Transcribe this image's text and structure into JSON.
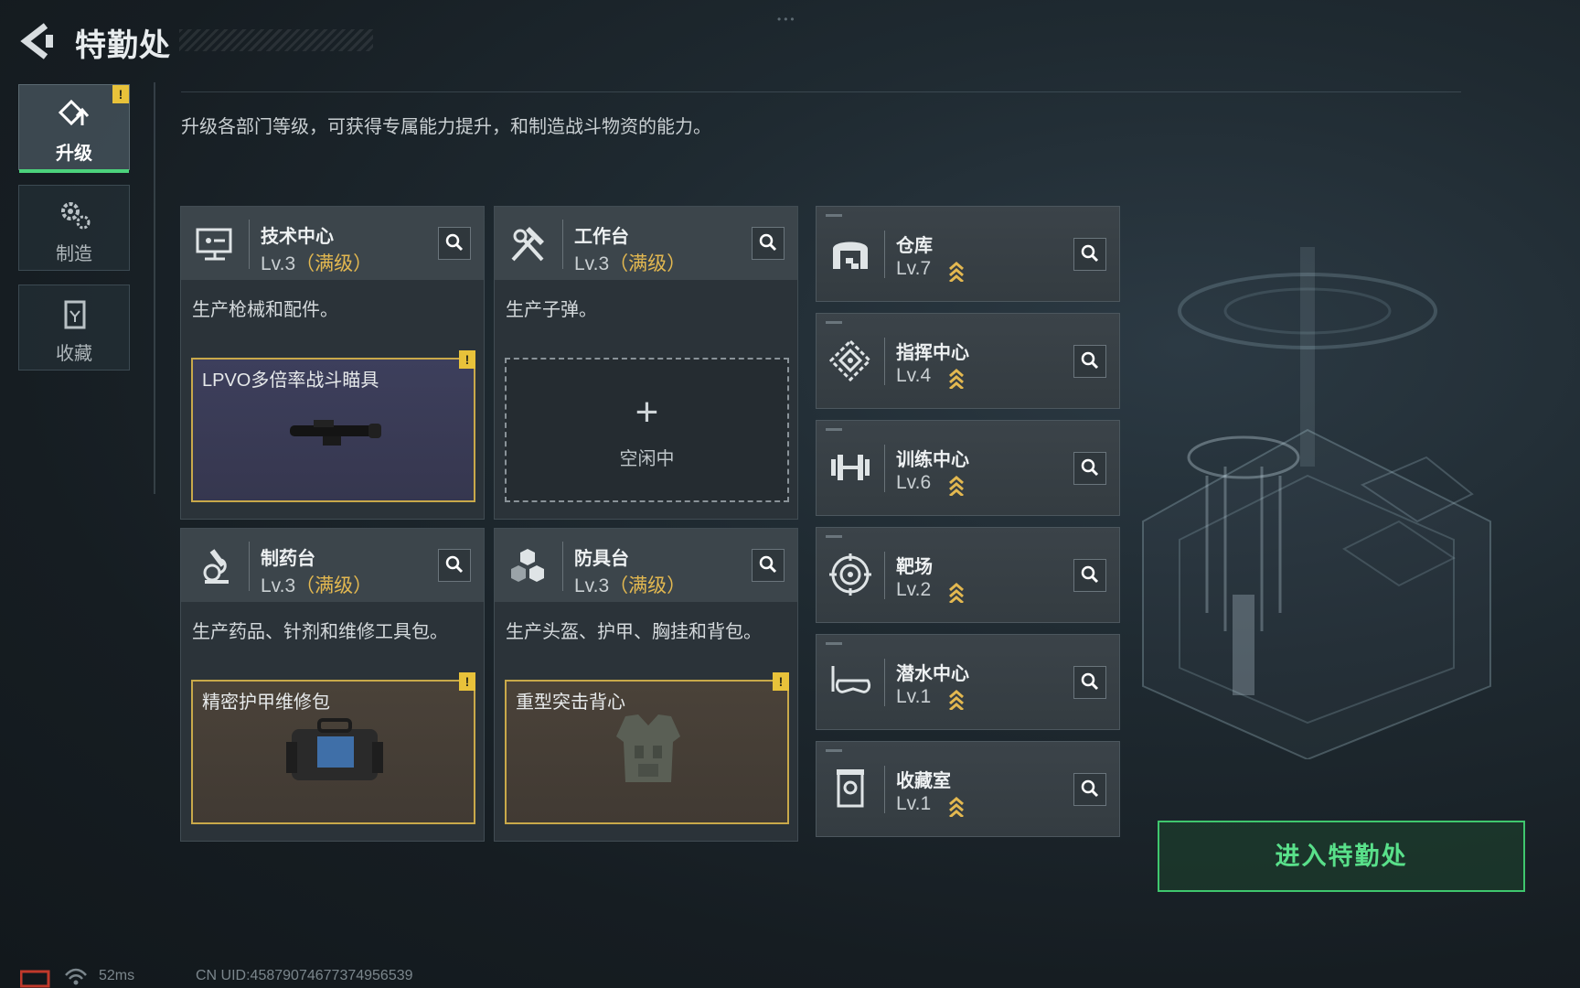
{
  "header": {
    "title": "特勤处"
  },
  "tabs": [
    {
      "label": "升级",
      "active": true,
      "alert": "!"
    },
    {
      "label": "制造",
      "active": false
    },
    {
      "label": "收藏",
      "active": false
    }
  ],
  "description": "升级各部门等级，可获得专属能力提升，和制造战斗物资的能力。",
  "cards": [
    {
      "name": "技术中心",
      "level": "Lv.3",
      "max": "（满级）",
      "desc": "生产枪械和配件。",
      "slot": {
        "item": "LPVO多倍率战斗瞄具",
        "alert": "!"
      }
    },
    {
      "name": "工作台",
      "level": "Lv.3",
      "max": "（满级）",
      "desc": "生产子弹。",
      "slot": {
        "idle_plus": "+",
        "idle_text": "空闲中"
      }
    },
    {
      "name": "制药台",
      "level": "Lv.3",
      "max": "（满级）",
      "desc": "生产药品、针剂和维修工具包。",
      "slot": {
        "item": "精密护甲维修包",
        "alert": "!"
      }
    },
    {
      "name": "防具台",
      "level": "Lv.3",
      "max": "（满级）",
      "desc": "生产头盔、护甲、胸挂和背包。",
      "slot": {
        "item": "重型突击背心",
        "alert": "!"
      }
    }
  ],
  "departments": [
    {
      "name": "仓库",
      "level": "Lv.7"
    },
    {
      "name": "指挥中心",
      "level": "Lv.4"
    },
    {
      "name": "训练中心",
      "level": "Lv.6"
    },
    {
      "name": "靶场",
      "level": "Lv.2"
    },
    {
      "name": "潜水中心",
      "level": "Lv.1"
    },
    {
      "name": "收藏室",
      "level": "Lv.1"
    }
  ],
  "enter_button": "进入特勤处",
  "status": {
    "ping": "52ms",
    "uid": "CN UID:458790746773749565​39"
  },
  "colors": {
    "accent": "#4cd27c",
    "max_level": "#e3b850",
    "alert": "#e8c23a"
  }
}
